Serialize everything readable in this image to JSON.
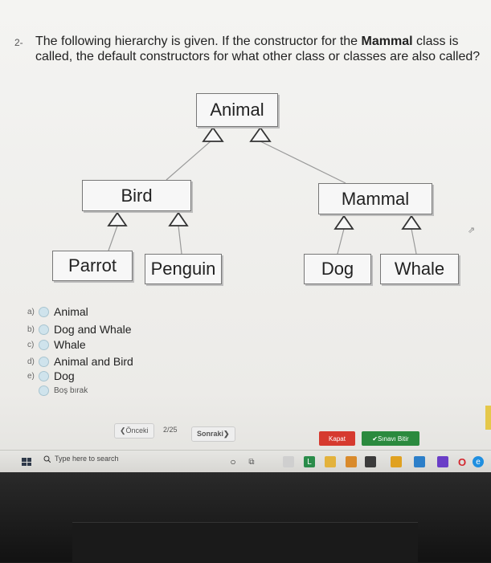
{
  "question": {
    "number": "2-",
    "text_before": "The following hierarchy is given. If the constructor for the ",
    "text_bold": "Mammal",
    "text_after": " class is called, the default constructors for what other class or classes are also called?"
  },
  "diagram": {
    "animal": "Animal",
    "bird": "Bird",
    "mammal": "Mammal",
    "parrot": "Parrot",
    "penguin": "Penguin",
    "dog": "Dog",
    "whale": "Whale"
  },
  "options": [
    {
      "letter": "a)",
      "label": "Animal"
    },
    {
      "letter": "b)",
      "label": "Dog and Whale"
    },
    {
      "letter": "c)",
      "label": "Whale"
    },
    {
      "letter": "d)",
      "label": "Animal and Bird"
    },
    {
      "letter": "e)",
      "label": "Dog"
    }
  ],
  "leave_blank": "Boş bırak",
  "nav": {
    "prev": "❮Önceki",
    "page": "2/25",
    "next": "Sonraki❯",
    "close": "Kapat",
    "finish": "✔Sınavı Bitir"
  },
  "taskbar": {
    "search_placeholder": "Type here to search"
  },
  "colors": {
    "close": "#d63a2f",
    "finish": "#2b8a3e",
    "radio": "#cfe3ec"
  },
  "icons": [
    "windows-icon",
    "search-icon",
    "cortana-icon",
    "task-view-icon",
    "taskbar-app-icons"
  ]
}
